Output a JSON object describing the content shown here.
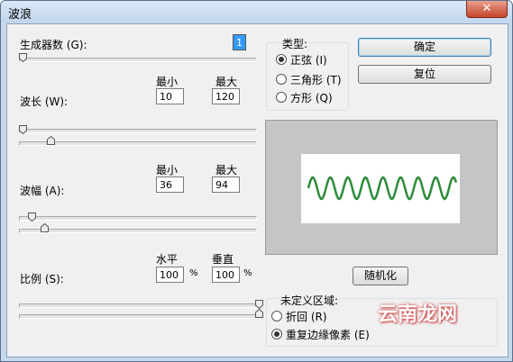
{
  "window": {
    "title": "波浪",
    "close_glyph": "✕"
  },
  "generators": {
    "label": "生成器数 (G):",
    "value": "1",
    "slider_level": 0.0
  },
  "wavelength": {
    "label": "波长 (W):",
    "min_header": "最小",
    "max_header": "最大",
    "min_value": "10",
    "max_value": "120",
    "min_slider_level": 0.0,
    "max_slider_level": 0.12
  },
  "amplitude": {
    "label": "波幅 (A):",
    "min_header": "最小",
    "max_header": "最大",
    "min_value": "36",
    "max_value": "94",
    "min_slider_level": 0.04,
    "max_slider_level": 0.09
  },
  "scale": {
    "label": "比例 (S):",
    "h_header": "水平",
    "v_header": "垂直",
    "h_value": "100",
    "v_value": "100",
    "unit": "%",
    "h_slider_level": 1.0,
    "v_slider_level": 1.0
  },
  "type_group": {
    "title": "类型:",
    "options": [
      {
        "label": "正弦 (I)",
        "selected": true
      },
      {
        "label": "三角形 (T)",
        "selected": false
      },
      {
        "label": "方形 (Q)",
        "selected": false
      }
    ]
  },
  "buttons": {
    "ok": "确定",
    "reset": "复位",
    "randomize": "随机化"
  },
  "undefined_area": {
    "title": "未定义区域:",
    "options": [
      {
        "label": "折回 (R)",
        "selected": false
      },
      {
        "label": "重复边缘像素 (E)",
        "selected": true
      }
    ]
  },
  "preview": {
    "wave_color": "#2e8b3a"
  },
  "watermark": "云南龙网"
}
